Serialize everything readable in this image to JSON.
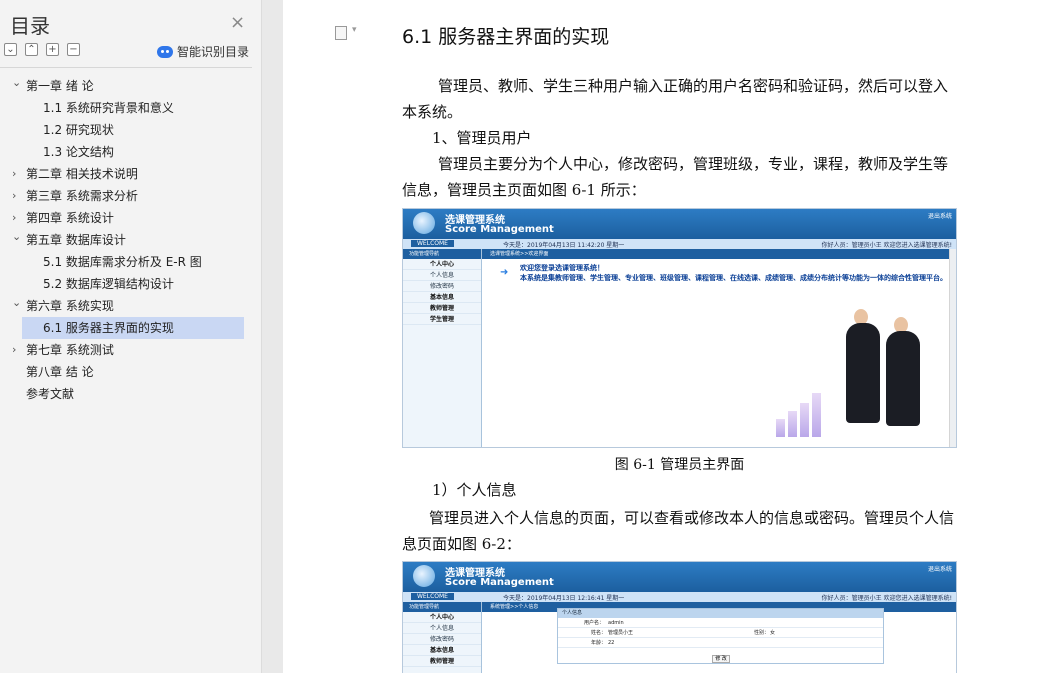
{
  "sidebar": {
    "title": "目录",
    "smart_label": "智能识别目录",
    "tools": [
      "⌄",
      "⌃",
      "+",
      "−"
    ],
    "items": [
      {
        "label": "第一章   绪   论",
        "level": 1,
        "expand": "v"
      },
      {
        "label": "1.1 系统研究背景和意义",
        "level": 2
      },
      {
        "label": "1.2 研究现状",
        "level": 2
      },
      {
        "label": "1.3 论文结构",
        "level": 2
      },
      {
        "label": "第二章   相关技术说明",
        "level": 1,
        "expand": ">"
      },
      {
        "label": "第三章   系统需求分析",
        "level": 1,
        "expand": ">"
      },
      {
        "label": " 第四章   系统设计",
        "level": 1,
        "expand": ">"
      },
      {
        "label": "第五章   数据库设计",
        "level": 1,
        "expand": "v"
      },
      {
        "label": "5.1 数据库需求分析及 E-R 图",
        "level": 2
      },
      {
        "label": "5.2  数据库逻辑结构设计",
        "level": 2
      },
      {
        "label": "第六章   系统实现",
        "level": 1,
        "expand": "v"
      },
      {
        "label": "6.1  服务器主界面的实现",
        "level": 2,
        "active": true
      },
      {
        "label": " 第七章   系统测试",
        "level": 1,
        "expand": ">"
      },
      {
        "label": "第八章   结   论",
        "level": 1
      },
      {
        "label": "参考文献",
        "level": 1
      }
    ]
  },
  "doc": {
    "section_title": "6.1  服务器主界面的实现",
    "p1": "管理员、教师、学生三种用户输入正确的用户名密码和验证码，然后可以登入本系统。",
    "p2": "1、管理员用户",
    "p3": "管理员主要分为个人中心，修改密码，管理班级，专业，课程，教师及学生等信息，管理员主页面如图 6-1 所示：",
    "caption1": "图 6-1   管理员主界面",
    "p4": "1）个人信息",
    "p5": "管理员进入个人信息的页面，可以查看或修改本人的信息或密码。管理员个人信息页面如图 6-2："
  },
  "ss1": {
    "title_cn": "选课管理系统",
    "title_en": "Score Management",
    "exit": "退出系统",
    "welcome": "WELCOME",
    "date": "今天是：2019年04月13日  11:42:20  星期一",
    "user": "你好人员：管理员小王   欢迎您进入选课管理系统!",
    "menu_header": "功能管理导航",
    "crumb": "选课管理系统>>欢迎界面",
    "menu": [
      {
        "t": "个人中心",
        "b": true
      },
      {
        "t": "个人信息",
        "b": false
      },
      {
        "t": "修改密码",
        "b": false
      },
      {
        "t": "基本信息",
        "b": true
      },
      {
        "t": "教师管理",
        "b": true
      },
      {
        "t": "学生管理",
        "b": true
      }
    ],
    "w1": "欢迎您登录选课管理系统！",
    "w2": "本系统是集教师管理、学生管理、专业管理、班级管理、课程管理、在线选课、成绩管理、成绩分布统计等功能为一体的综合性管理平台。"
  },
  "ss2": {
    "title_cn": "选课管理系统",
    "title_en": "Score Management",
    "exit": "退出系统",
    "welcome": "WELCOME",
    "date": "今天是：2019年04月13日  12:16:41  星期一",
    "user": "你好人员：管理员小王   欢迎您进入选课管理系统!",
    "menu_header": "功能管理导航",
    "crumb": "系统管理>>个人信息",
    "menu": [
      {
        "t": "个人中心",
        "b": true
      },
      {
        "t": "个人信息",
        "b": false
      },
      {
        "t": "修改密码",
        "b": false
      },
      {
        "t": "基本信息",
        "b": true
      },
      {
        "t": "教师管理",
        "b": true
      }
    ],
    "form_title": "个人信息",
    "username_label": "用户名：",
    "username": "admin",
    "name_label": "姓名：",
    "name": "管理员小王",
    "gender_label": "性别：",
    "gender": "女",
    "age_label": "年龄：",
    "age": "22",
    "button": "修 改"
  }
}
